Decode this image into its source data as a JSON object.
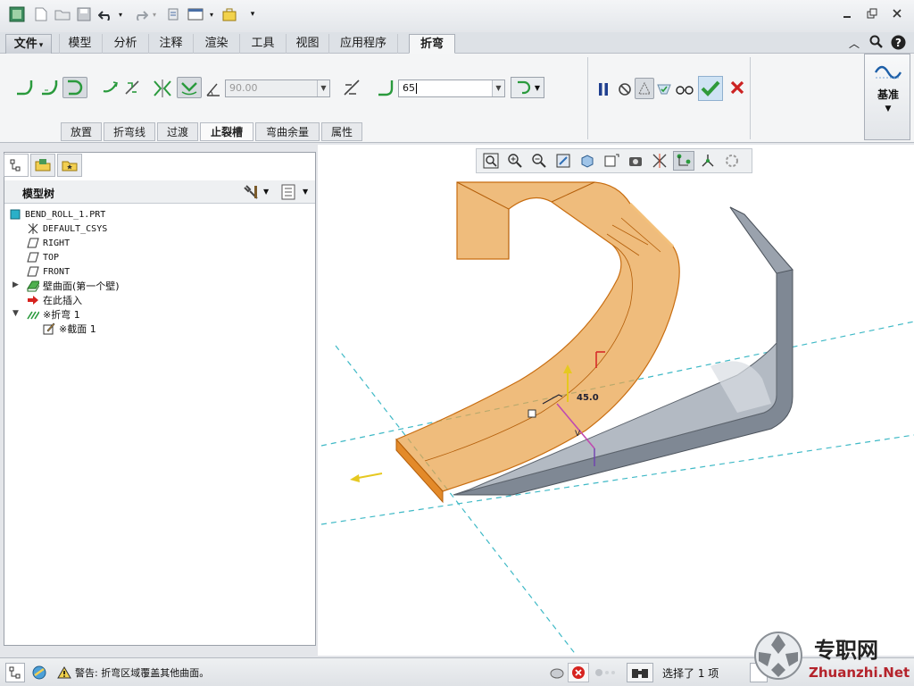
{
  "ribbon": {
    "tabs": [
      {
        "label": "文件",
        "arrow": "▾"
      },
      {
        "label": "模型"
      },
      {
        "label": "分析"
      },
      {
        "label": "注释"
      },
      {
        "label": "渲染"
      },
      {
        "label": "工具"
      },
      {
        "label": "视图"
      },
      {
        "label": "应用程序"
      },
      {
        "label": "折弯"
      }
    ],
    "angle_value": "90.00",
    "radius_value": "65",
    "subtabs": [
      "放置",
      "折弯线",
      "过渡",
      "止裂槽",
      "弯曲余量",
      "属性"
    ],
    "datum_label": "基准"
  },
  "model_tree": {
    "title": "模型树",
    "items": [
      {
        "label": "BEND_ROLL_1.PRT"
      },
      {
        "label": "DEFAULT_CSYS"
      },
      {
        "label": "RIGHT"
      },
      {
        "label": "TOP"
      },
      {
        "label": "FRONT"
      },
      {
        "label": "壁曲面(第一个壁)"
      },
      {
        "label": "在此插入"
      },
      {
        "label": "※折弯 1"
      },
      {
        "label": "※截面 1"
      }
    ]
  },
  "graphics": {
    "dimension_label": "45.0"
  },
  "status": {
    "warning": "警告: 折弯区域覆盖其他曲面。",
    "selection": "选择了 1 项"
  },
  "watermark": {
    "cn": "专职网",
    "en": "Zhuanzhi.Net"
  },
  "colors": {
    "accent_orange": "#e9a24a",
    "part_gray": "#7f8894",
    "accept_green": "#2f9a3a",
    "cancel_red": "#cc2222"
  }
}
